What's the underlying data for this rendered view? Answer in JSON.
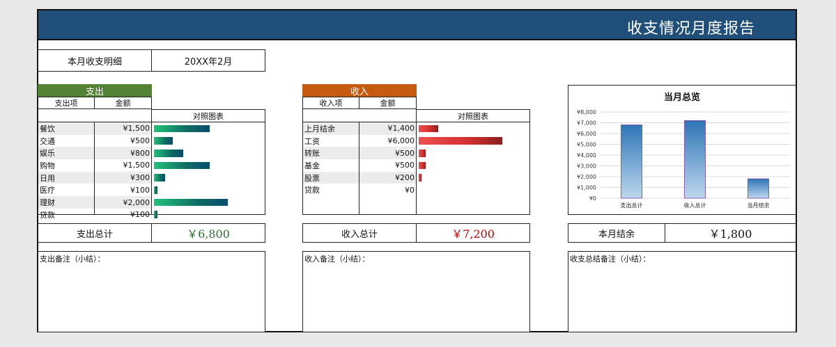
{
  "title": "收支情况月度报告",
  "month": {
    "label": "本月收支明细",
    "value": "20XX年2月"
  },
  "expense": {
    "header": "支出",
    "col_item": "支出项",
    "col_amount": "金额",
    "col_chart": "对照图表",
    "rows": [
      {
        "item": "餐饮",
        "amount": "¥1,500",
        "value": 1500
      },
      {
        "item": "交通",
        "amount": "¥500",
        "value": 500
      },
      {
        "item": "娱乐",
        "amount": "¥800",
        "value": 800
      },
      {
        "item": "购物",
        "amount": "¥1,500",
        "value": 1500
      },
      {
        "item": "日用",
        "amount": "¥300",
        "value": 300
      },
      {
        "item": "医疗",
        "amount": "¥100",
        "value": 100
      },
      {
        "item": "理财",
        "amount": "¥2,000",
        "value": 2000
      },
      {
        "item": "贷款",
        "amount": "¥100",
        "value": 100
      }
    ],
    "total_label": "支出总计",
    "total_value": "￥6,800",
    "note_label": "支出备注（小结）："
  },
  "income": {
    "header": "收入",
    "col_item": "收入项",
    "col_amount": "金额",
    "col_chart": "对照图表",
    "rows": [
      {
        "item": "上月结余",
        "amount": "¥1,400",
        "value": 1400
      },
      {
        "item": "工资",
        "amount": "¥6,000",
        "value": 6000
      },
      {
        "item": "转账",
        "amount": "¥500",
        "value": 500
      },
      {
        "item": "基金",
        "amount": "¥500",
        "value": 500
      },
      {
        "item": "股票",
        "amount": "¥200",
        "value": 200
      },
      {
        "item": "贷款",
        "amount": "¥0",
        "value": 0
      }
    ],
    "total_label": "收入总计",
    "total_value": "￥7,200",
    "note_label": "收入备注（小结）："
  },
  "summary": {
    "balance_label": "本月结余",
    "balance_value": "￥1,800",
    "note_label": "收支总结备注（小结）："
  },
  "chart_data": {
    "type": "bar",
    "title": "当月总览",
    "categories": [
      "支出总计",
      "收入总计",
      "当月结余"
    ],
    "values": [
      6800,
      7200,
      1800
    ],
    "ylim": [
      0,
      8000
    ],
    "yticks": [
      "¥0",
      "¥1,000",
      "¥2,000",
      "¥3,000",
      "¥4,000",
      "¥5,000",
      "¥6,000",
      "¥7,000",
      "¥8,000"
    ],
    "grid": true,
    "colors": {
      "bar_top": "#2e75b6",
      "bar_bottom": "#bdd7ee"
    }
  },
  "colors": {
    "header_bg": "#1f4e79",
    "expense_header": "#548235",
    "income_header": "#c55a11",
    "expense_total": "#2e6b2e",
    "income_total": "#c00000"
  }
}
